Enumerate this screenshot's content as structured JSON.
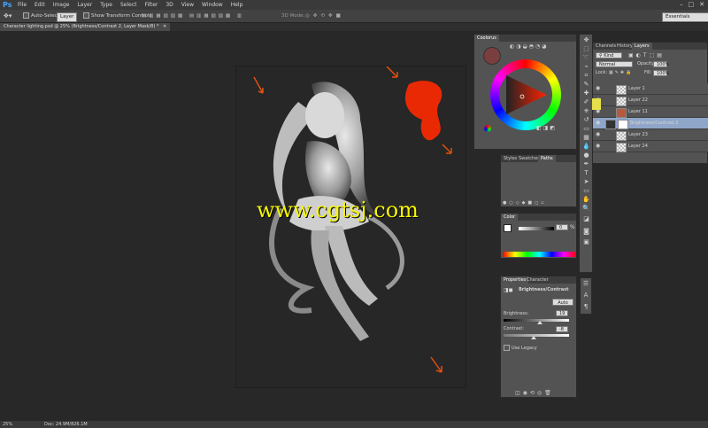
{
  "app": {
    "logo": "Ps"
  },
  "menu": [
    "File",
    "Edit",
    "Image",
    "Layer",
    "Type",
    "Select",
    "Filter",
    "3D",
    "View",
    "Window",
    "Help"
  ],
  "window_controls": {
    "minimize": "–",
    "restore": "□",
    "close": "✕"
  },
  "options": {
    "auto_select_label": "Auto-Select:",
    "auto_select_value": "Layer",
    "transform_label": "Show Transform Controls",
    "mode_3d": "3D Mode:",
    "workspace": "Essentials"
  },
  "document": {
    "tab_title": "Character lighting.psd @ 25% (Brightness/Contrast 2, Layer Mask/8) *",
    "close": "✕"
  },
  "watermark": "www.cgtsj.com",
  "status": {
    "zoom": "25%",
    "doc_info": "Doc: 24.9M/826.1M"
  },
  "coolorus": {
    "title": "Coolorus",
    "current_color": "#7a3e3e"
  },
  "styles_panel": {
    "tabs": [
      "Styles",
      "Swatches",
      "Paths"
    ]
  },
  "color_panel": {
    "title": "Color",
    "value": "0",
    "unit": "%"
  },
  "properties_panel": {
    "tabs": [
      "Properties",
      "Character"
    ],
    "adjustment_title": "Brightness/Contrast",
    "auto_label": "Auto",
    "brightness_label": "Brightness:",
    "brightness_value": "19",
    "brightness_fraction": 0.56,
    "contrast_label": "Contrast:",
    "contrast_value": "-8",
    "contrast_fraction": 0.46,
    "legacy_label": "Use Legacy"
  },
  "layers_panel": {
    "tabs": [
      "Channels",
      "History",
      "Layers"
    ],
    "kind": "Kind",
    "blend_mode": "Normal",
    "opacity_label": "Opacity:",
    "opacity_value": "100%",
    "lock_label": "Lock:",
    "fill_label": "Fill:",
    "fill_value": "100%",
    "layers": [
      {
        "name": "Layer 1",
        "color": "#535353",
        "thumb": "checker"
      },
      {
        "name": "Layer 22",
        "color": "#535353",
        "thumb": "checker"
      },
      {
        "name": "Layer 11",
        "color": "#535353",
        "thumb": "#b55a3c"
      },
      {
        "name": "Brightness/Contrast 2",
        "color": "#8fa6c9",
        "thumb": "adjust"
      },
      {
        "name": "Layer 23",
        "color": "#535353",
        "thumb": "checker"
      },
      {
        "name": "Layer 24",
        "color": "#535353",
        "thumb": "checker"
      }
    ]
  },
  "accent_colors": {
    "paint_red": "#ff2a00",
    "arrow_orange": "#e0500f",
    "selection_blue": "#8fa6c9"
  }
}
